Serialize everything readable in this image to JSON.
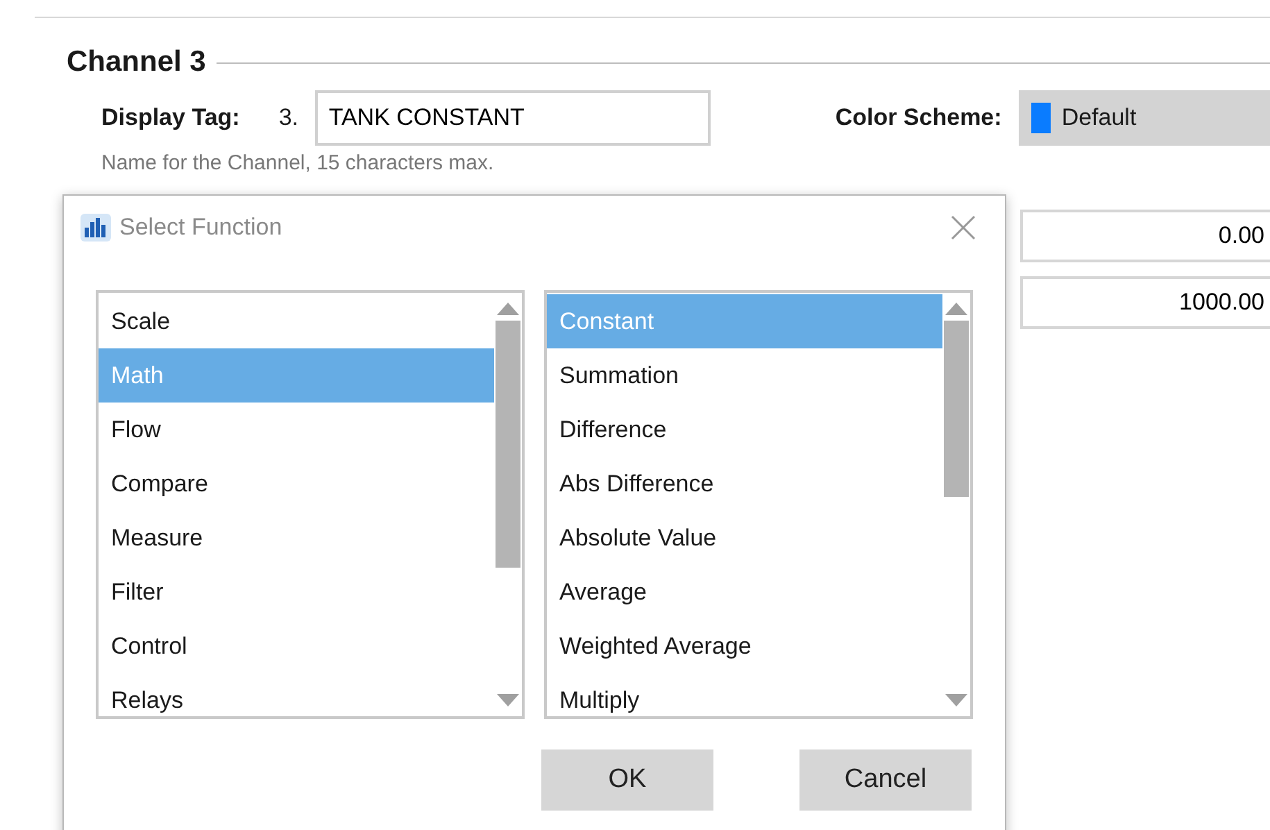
{
  "section": {
    "title": "Channel 3"
  },
  "display_tag": {
    "label": "Display Tag:",
    "number": "3.",
    "value": "TANK CONSTANT",
    "hint": "Name for the Channel, 15 characters max."
  },
  "color_scheme": {
    "label": "Color Scheme:",
    "value": "Default",
    "color": "#0a7cff"
  },
  "range_fields": [
    "0.00",
    "1000.00"
  ],
  "dialog": {
    "title": "Select Function",
    "categories": [
      {
        "label": "Scale",
        "selected": false
      },
      {
        "label": "Math",
        "selected": true
      },
      {
        "label": "Flow",
        "selected": false
      },
      {
        "label": "Compare",
        "selected": false
      },
      {
        "label": "Measure",
        "selected": false
      },
      {
        "label": "Filter",
        "selected": false
      },
      {
        "label": "Control",
        "selected": false
      },
      {
        "label": "Relays",
        "selected": false
      }
    ],
    "functions": [
      {
        "label": "Constant",
        "selected": true
      },
      {
        "label": "Summation",
        "selected": false
      },
      {
        "label": "Difference",
        "selected": false
      },
      {
        "label": "Abs Difference",
        "selected": false
      },
      {
        "label": "Absolute Value",
        "selected": false
      },
      {
        "label": "Average",
        "selected": false
      },
      {
        "label": "Weighted Average",
        "selected": false
      },
      {
        "label": "Multiply",
        "selected": false
      }
    ],
    "buttons": [
      "OK",
      "Cancel"
    ]
  }
}
